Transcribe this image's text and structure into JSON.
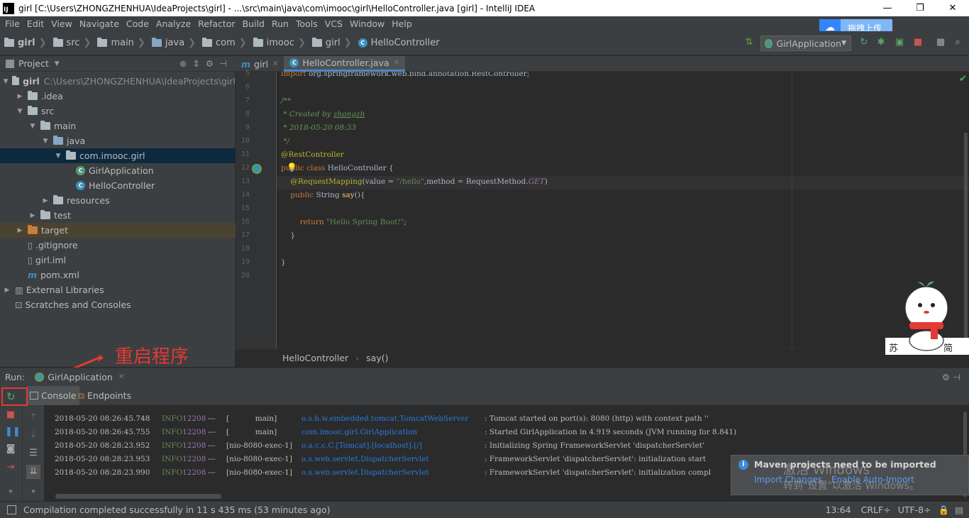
{
  "window": {
    "title": "girl [C:\\Users\\ZHONGZHENHUA\\IdeaProjects\\girl] - ...\\src\\main\\java\\com\\imooc\\girl\\HelloController.java [girl] - IntelliJ IDEA",
    "logo": "IJ"
  },
  "menu": [
    "File",
    "Edit",
    "View",
    "Navigate",
    "Code",
    "Analyze",
    "Refactor",
    "Build",
    "Run",
    "Tools",
    "VCS",
    "Window",
    "Help"
  ],
  "baidu": {
    "label": "拖拽上传"
  },
  "breadcrumbs": [
    "girl",
    "src",
    "main",
    "java",
    "com",
    "imooc",
    "girl",
    "HelloController"
  ],
  "run_config": "GirlApplication",
  "project": {
    "header": "Project",
    "tree": [
      {
        "label": "girl",
        "extra": "C:\\Users\\ZHONGZHENHUA\\IdeaProjects\\girl",
        "indent": 0,
        "arrow": "▼",
        "icon": "folder"
      },
      {
        "label": ".idea",
        "indent": 1,
        "arrow": "▶",
        "icon": "folder"
      },
      {
        "label": "src",
        "indent": 1,
        "arrow": "▼",
        "icon": "folder"
      },
      {
        "label": "main",
        "indent": 2,
        "arrow": "▼",
        "icon": "folder"
      },
      {
        "label": "java",
        "indent": 3,
        "arrow": "▼",
        "icon": "folder-blue"
      },
      {
        "label": "com.imooc.girl",
        "indent": 4,
        "arrow": "▼",
        "icon": "folder"
      },
      {
        "label": "GirlApplication",
        "indent": 5,
        "arrow": "",
        "icon": "class-spring"
      },
      {
        "label": "HelloController",
        "indent": 5,
        "arrow": "",
        "icon": "class"
      },
      {
        "label": "resources",
        "indent": 3,
        "arrow": "▶",
        "icon": "folder"
      },
      {
        "label": "test",
        "indent": 2,
        "arrow": "▶",
        "icon": "folder"
      },
      {
        "label": "target",
        "indent": 1,
        "arrow": "▶",
        "icon": "folder-orange"
      },
      {
        "label": ".gitignore",
        "indent": 1,
        "arrow": "",
        "icon": "file"
      },
      {
        "label": "girl.iml",
        "indent": 1,
        "arrow": "",
        "icon": "file"
      },
      {
        "label": "pom.xml",
        "indent": 1,
        "arrow": "",
        "icon": "maven"
      },
      {
        "label": "External Libraries",
        "indent": 0,
        "arrow": "▶",
        "icon": "lib"
      },
      {
        "label": "Scratches and Consoles",
        "indent": 0,
        "arrow": "",
        "icon": "scratch"
      }
    ]
  },
  "tabs": [
    {
      "label": "girl",
      "icon": "m"
    },
    {
      "label": "HelloController.java",
      "icon": "class"
    }
  ],
  "editor": {
    "line_numbers": [
      "5",
      "6",
      "7",
      "8",
      "9",
      "10",
      "11",
      "12",
      "13",
      "14",
      "15",
      "16",
      "17",
      "18",
      "19",
      "20"
    ],
    "breadcrumb": [
      "HelloController",
      "say()"
    ]
  },
  "annotation": "重启程序",
  "run": {
    "label": "Run:",
    "tab": "GirlApplication",
    "subtabs": [
      "Console",
      "Endpoints"
    ]
  },
  "log": [
    {
      "ts": "2018-05-20 08:26:45.748",
      "lvl": "INFO",
      "pid": "12208",
      "sep": "---",
      "thread": "[           main]",
      "cls": "o.s.b.w.embedded.tomcat.TomcatWebServer",
      "msg": ": Tomcat started on port(s): 8080 (http) with context path ''"
    },
    {
      "ts": "2018-05-20 08:26:45.755",
      "lvl": "INFO",
      "pid": "12208",
      "sep": "---",
      "thread": "[           main]",
      "cls": "com.imooc.girl.GirlApplication",
      "msg": ": Started GirlApplication in 4.919 seconds (JVM running for 8.841)"
    },
    {
      "ts": "2018-05-20 08:28:23.952",
      "lvl": "INFO",
      "pid": "12208",
      "sep": "---",
      "thread": "[nio-8080-exec-1]",
      "cls": "o.a.c.c.C.[Tomcat].[localhost].[/]",
      "msg": ": Initializing Spring FrameworkServlet 'dispatcherServlet'"
    },
    {
      "ts": "2018-05-20 08:28:23.953",
      "lvl": "INFO",
      "pid": "12208",
      "sep": "---",
      "thread": "[nio-8080-exec-1]",
      "cls": "o.s.web.servlet.DispatcherServlet",
      "msg": ": FrameworkServlet 'dispatcherServlet': initialization start"
    },
    {
      "ts": "2018-05-20 08:28:23.990",
      "lvl": "INFO",
      "pid": "12208",
      "sep": "---",
      "thread": "[nio-8080-exec-1]",
      "cls": "o.s.web.servlet.DispatcherServlet",
      "msg": ": FrameworkServlet 'dispatcherServlet': initialization compl"
    }
  ],
  "notification": {
    "title": "Maven projects need to be imported",
    "link1": "Import Changes",
    "link2": "Enable Auto-Import"
  },
  "watermark": {
    "line1": "激活 Windows",
    "line2": "转到\"设置\"以激活 Windows。"
  },
  "mascot": {
    "left_char": "苏",
    "right_char": "简"
  },
  "status": {
    "message": "Compilation completed successfully in 11 s 435 ms (53 minutes ago)",
    "position": "13:64",
    "line_sep": "CRLF÷",
    "encoding": "UTF-8÷"
  },
  "colors": {
    "accent": "#4a88c7",
    "annotation": "#e53935",
    "selection": "#0d293e"
  }
}
